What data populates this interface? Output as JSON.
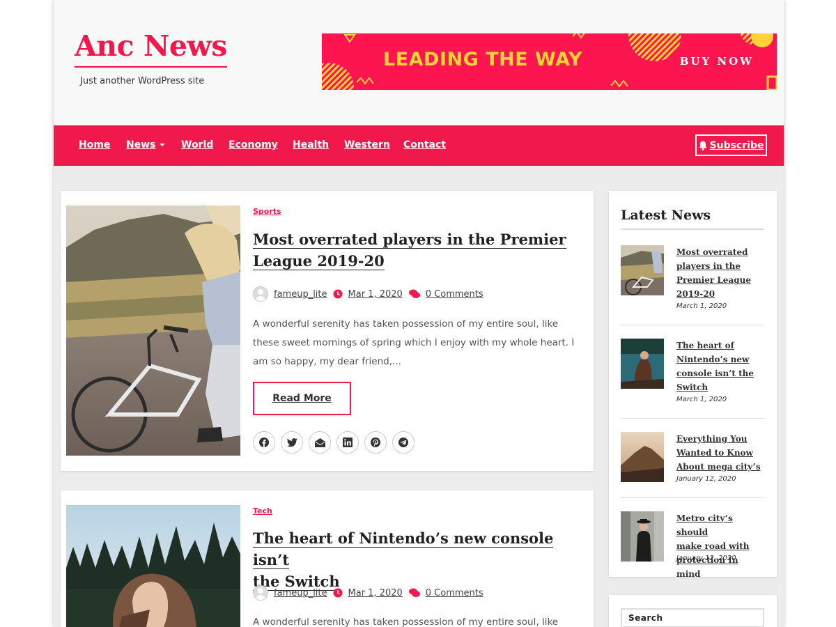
{
  "site": {
    "title": "Anc News",
    "tagline": "Just another WordPress site",
    "accent": "#f1194b"
  },
  "banner": {
    "headline": "LEADING THE WAY",
    "cta": "BUY NOW",
    "background": "#fd1550",
    "headline_color": "#ffd23a"
  },
  "nav": {
    "items": [
      "Home",
      "News",
      "World",
      "Economy",
      "Health",
      "Western",
      "Contact"
    ],
    "subscribe_label": "Subscribe",
    "subscribe_icon": "bell-icon"
  },
  "posts": [
    {
      "category": "Sports",
      "title_line1": "Most overrated players in the Premier",
      "title_line2": "League 2019-20",
      "author": "fameup_lite",
      "date": "Mar 1, 2020",
      "comments": "0 Comments",
      "excerpt": "A wonderful serenity has taken possession of my entire soul, like these sweet mornings of spring which I enjoy with my whole heart. I am so happy, my dear friend,...",
      "read_more": "Read More"
    },
    {
      "category": "Tech",
      "title_line1": "The heart of Nintendo’s new console isn’t",
      "title_line2": "the Switch",
      "author": "fameup_lite",
      "date": "Mar 1, 2020",
      "comments": "0 Comments",
      "excerpt": "A wonderful serenity has taken possession of my entire soul, like"
    }
  ],
  "share_icons": [
    "facebook-icon",
    "twitter-icon",
    "email-icon",
    "linkedin-icon",
    "pinterest-icon",
    "telegram-icon"
  ],
  "sidebar": {
    "latest_title": "Latest News",
    "latest": [
      {
        "title_lines": [
          "Most overrated",
          "players in the",
          "Premier League",
          "2019-20"
        ],
        "date": "March 1, 2020"
      },
      {
        "title_lines": [
          "The heart of",
          "Nintendo’s new",
          "console isn’t the",
          "Switch"
        ],
        "date": "March 1, 2020"
      },
      {
        "title_lines": [
          "Everything You",
          "Wanted to Know",
          "About mega city’s"
        ],
        "date": "January 12, 2020"
      },
      {
        "title_lines": [
          "Metro city’s should",
          "make road with",
          "protection In mind"
        ],
        "date": "January 12, 2020"
      }
    ],
    "search_label": "Search"
  }
}
